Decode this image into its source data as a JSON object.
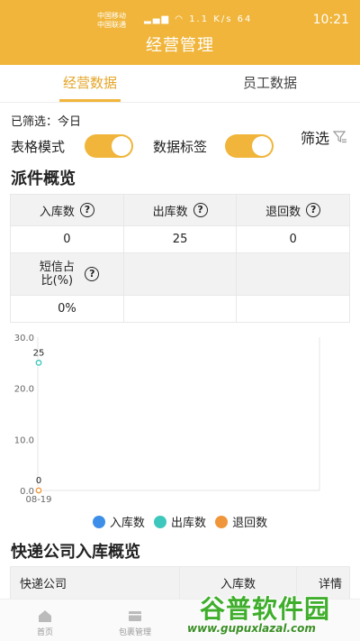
{
  "status_bar": {
    "carrier1": "中国移动",
    "carrier2": "中国联通",
    "speed": "1.1 K/s",
    "battery": "64",
    "time": "10:21"
  },
  "header": {
    "title": "经营管理"
  },
  "tabs": [
    {
      "label": "经营数据",
      "active": true
    },
    {
      "label": "员工数据",
      "active": false
    }
  ],
  "filter": {
    "summary": "已筛选：今日",
    "button_label": "筛选"
  },
  "toggles": [
    {
      "label": "表格模式",
      "on": true
    },
    {
      "label": "数据标签",
      "on": true
    }
  ],
  "dispatch": {
    "title": "派件概览",
    "headers": [
      "入库数",
      "出库数",
      "退回数"
    ],
    "values": [
      "0",
      "25",
      "0"
    ],
    "sms_header": "短信占比(%)",
    "sms_value": "0%"
  },
  "chart_data": {
    "type": "line",
    "x": [
      "08-19"
    ],
    "series": [
      {
        "name": "入库数",
        "values": [
          0
        ],
        "color": "#3d8ee8"
      },
      {
        "name": "出库数",
        "values": [
          25
        ],
        "color": "#3ec7bc"
      },
      {
        "name": "退回数",
        "values": [
          0
        ],
        "color": "#f0963a"
      }
    ],
    "yticks": [
      "0.0",
      "10.0",
      "20.0",
      "30.0"
    ],
    "ylim": [
      0,
      30
    ],
    "data_labels": [
      "25",
      "0"
    ],
    "xlabel": "",
    "ylabel": "",
    "grid": false,
    "legend": "bottom"
  },
  "courier": {
    "title": "快递公司入库概览",
    "headers": [
      "快递公司",
      "入库数",
      "详情"
    ]
  },
  "bottom_nav": [
    {
      "label": "首页",
      "icon": "home-icon"
    },
    {
      "label": "包裹管理",
      "icon": "package-icon"
    }
  ],
  "watermark": {
    "text": "谷普软件园",
    "url": "www.gupuxlazal.com"
  }
}
